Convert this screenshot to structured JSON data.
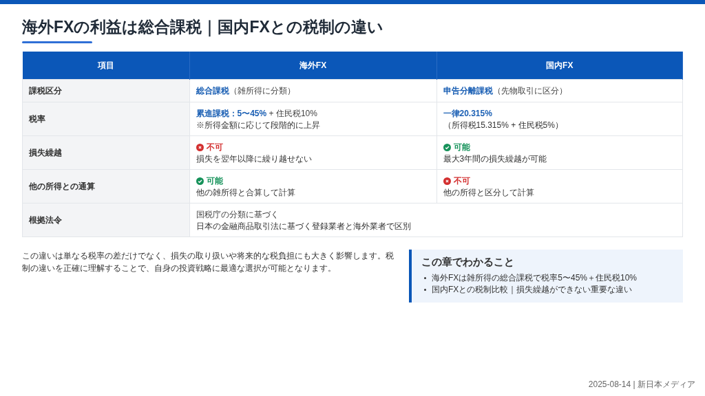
{
  "title": "海外FXの利益は総合課税｜国内FXとの税制の違い",
  "table": {
    "columns": [
      "項目",
      "海外FX",
      "国内FX"
    ],
    "rows": [
      {
        "cells": [
          {
            "kind": "label",
            "main": "課税区分"
          },
          {
            "kind": "text",
            "highlight": false,
            "main": "**総合課税**（雑所得に分類）"
          },
          {
            "kind": "text",
            "highlight": false,
            "main": "**申告分離課税**（先物取引に区分）"
          }
        ]
      },
      {
        "cells": [
          {
            "kind": "label",
            "main": "税率"
          },
          {
            "kind": "text",
            "highlight": false,
            "main": "**累進課税：5〜45%** + 住民税10%",
            "note": "※所得金額に応じて段階的に上昇"
          },
          {
            "kind": "text",
            "highlight": true,
            "main": "一律20.315%",
            "note": "（所得税15.315% + 住民税5%）"
          }
        ]
      },
      {
        "cells": [
          {
            "kind": "label",
            "main": "損失繰越"
          },
          {
            "kind": "status",
            "ok": false,
            "main": "不可",
            "note": "損失を翌年以降に繰り越せない"
          },
          {
            "kind": "status",
            "ok": true,
            "main": "可能",
            "note": "最大3年間の損失繰越が可能"
          }
        ]
      },
      {
        "cells": [
          {
            "kind": "label",
            "main": "他の所得との通算"
          },
          {
            "kind": "status",
            "ok": true,
            "main": "可能",
            "note": "他の雑所得と合算して計算"
          },
          {
            "kind": "status",
            "ok": false,
            "main": "不可",
            "note": "他の所得と区分して計算"
          }
        ]
      },
      {
        "cells": [
          {
            "kind": "label",
            "main": "根拠法令"
          },
          {
            "kind": "text",
            "highlight": false,
            "colspan": 2,
            "main": "国税庁の分類に基づく",
            "note": "日本の金融商品取引法に基づく登録業者と海外業者で区別"
          }
        ]
      }
    ]
  },
  "paragraph": "この違いは単なる税率の差だけでなく、損失の取り扱いや将来的な税負担にも大きく影響します。税制の違いを正確に理解することで、自身の投資戦略に最適な選択が可能となります。",
  "summary": {
    "heading": "この章でわかること",
    "items": [
      "海外FXは雑所得の総合課税で税率5〜45%＋住民税10%",
      "国内FXとの税制比較｜損失繰越ができない重要な違い"
    ]
  },
  "footer": "2025-08-14 | 新日本メディア"
}
